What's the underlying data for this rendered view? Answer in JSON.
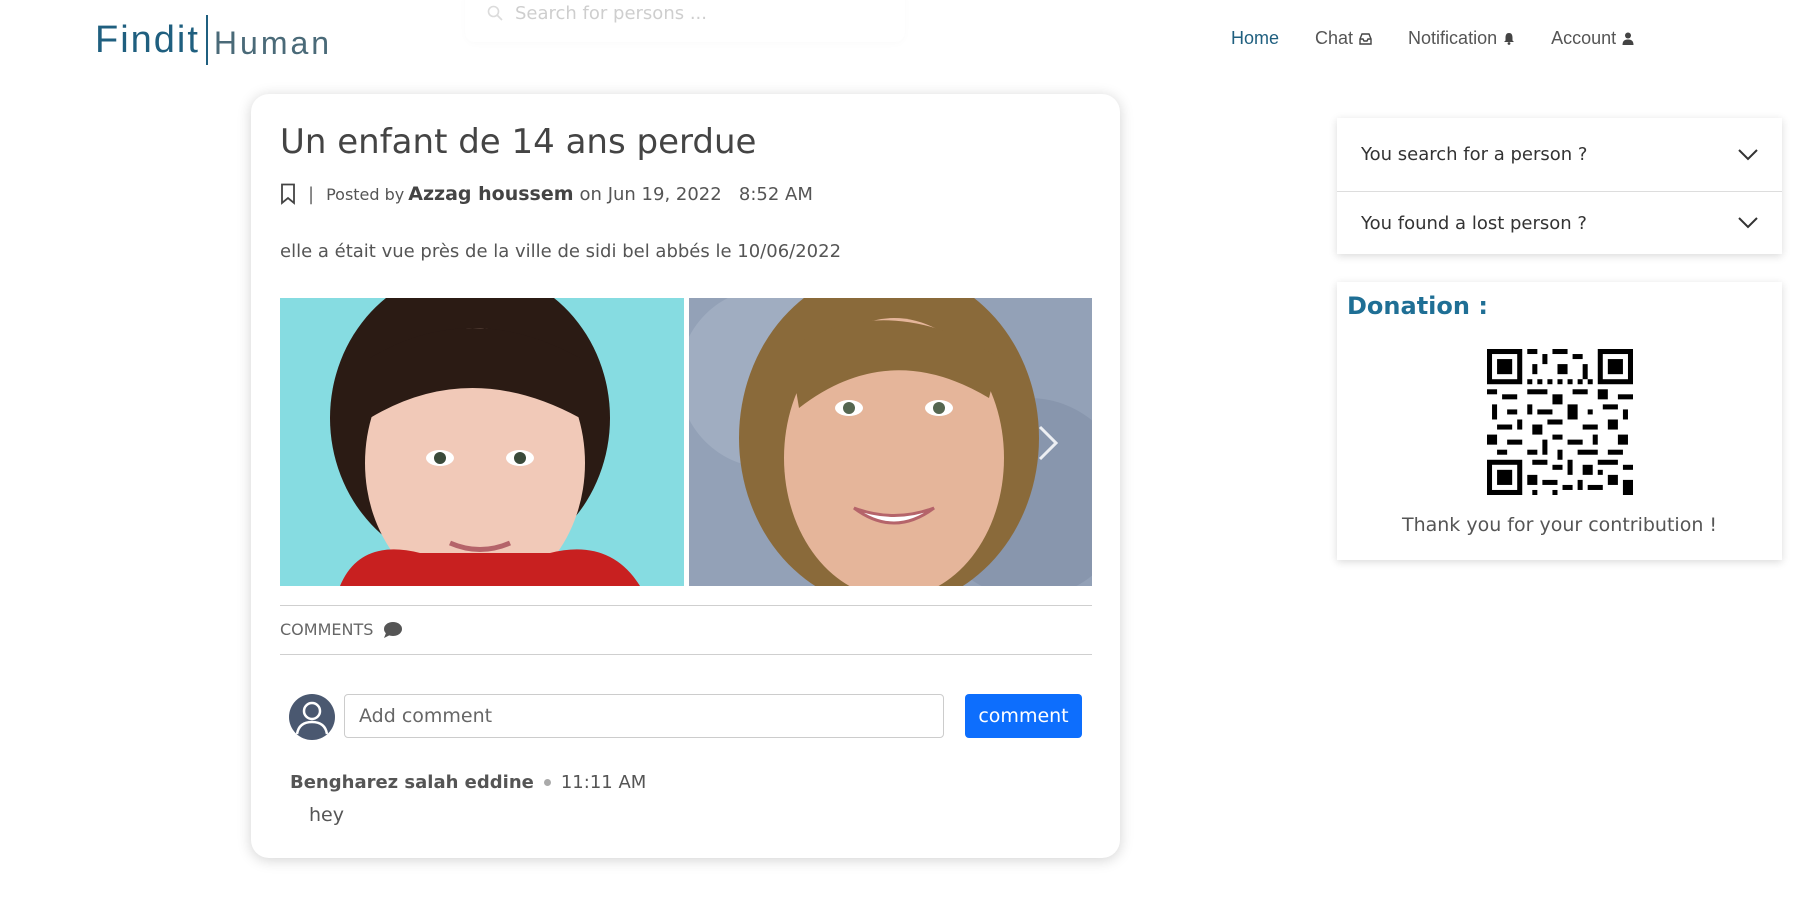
{
  "header": {
    "logo_part1": "Findit",
    "logo_part2": "Human",
    "search_placeholder": "Search for persons ...",
    "nav": {
      "home": "Home",
      "chat": "Chat",
      "notification": "Notification",
      "account": "Account"
    },
    "accent_color": "#1f5f7f"
  },
  "post": {
    "title": "Un enfant de 14 ans perdue",
    "separator": "|",
    "posted_by_label": "Posted by",
    "author": "Azzag houssem",
    "on_label": "on",
    "date": "Jun 19, 2022",
    "time": "8:52 AM",
    "description": "elle a était vue près de la ville de sidi bel abbés le 10/06/2022",
    "comments_label": "COMMENTS",
    "comment_placeholder": "Add comment",
    "comment_button": "comment",
    "comments": [
      {
        "author": "Bengharez salah eddine",
        "time": "11:11 AM",
        "text": "hey"
      }
    ]
  },
  "sidebar": {
    "accordion": [
      {
        "label": "You search for a person ?"
      },
      {
        "label": "You found a lost person ?"
      }
    ],
    "donation_title": "Donation :",
    "donation_thanks": "Thank you for your contribution !"
  },
  "colors": {
    "primary_button": "#0d6efd",
    "donation_title": "#1f6f95"
  }
}
